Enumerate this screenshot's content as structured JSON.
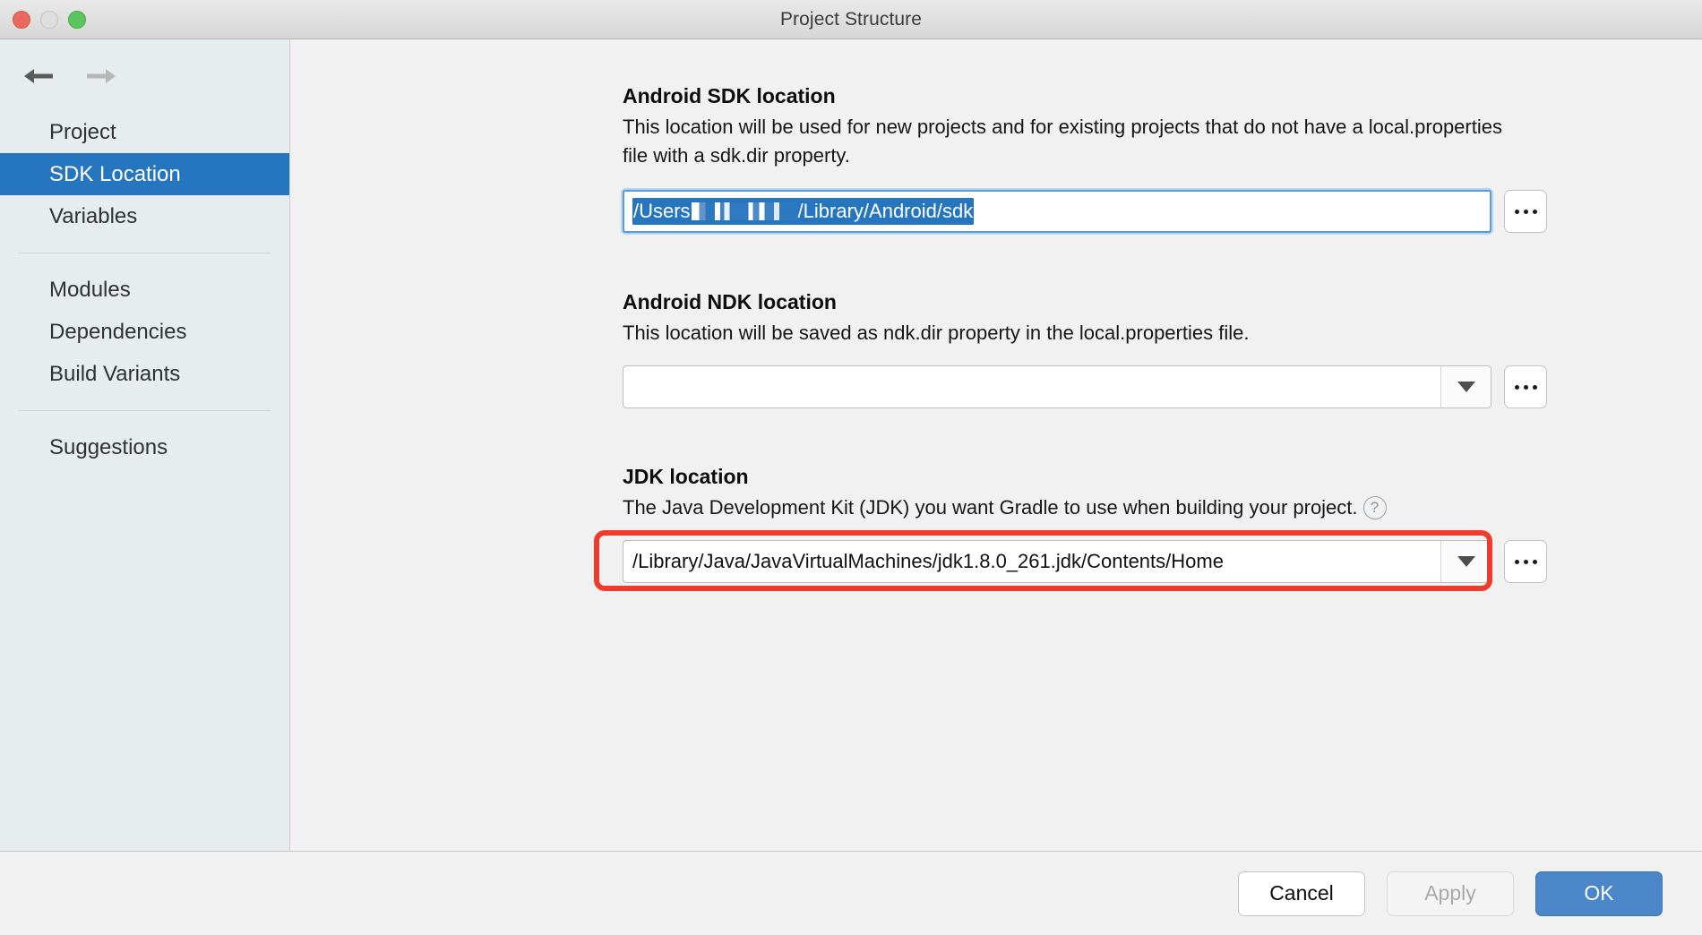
{
  "window": {
    "title": "Project Structure",
    "controls": {
      "close": "close",
      "minimize": "minimize",
      "maximize": "maximize"
    }
  },
  "nav": {
    "back_label": "Back",
    "forward_label": "Forward",
    "items": [
      {
        "label": "Project",
        "selected": false
      },
      {
        "label": "SDK Location",
        "selected": true
      },
      {
        "label": "Variables",
        "selected": false
      },
      {
        "label": "Modules",
        "selected": false
      },
      {
        "label": "Dependencies",
        "selected": false
      },
      {
        "label": "Build Variants",
        "selected": false
      },
      {
        "label": "Suggestions",
        "selected": false
      }
    ]
  },
  "sections": {
    "sdk": {
      "title": "Android SDK location",
      "description": "This location will be used for new projects and for existing projects that do not have a local.properties file with a sdk.dir property.",
      "value_prefix": "/Users",
      "value_suffix": "/Library/Android/sdk",
      "browse_label": "...",
      "redacted": true
    },
    "ndk": {
      "title": "Android NDK location",
      "description": "This location will be saved as ndk.dir property in the local.properties file.",
      "value": "",
      "browse_label": "...",
      "dropdown_label": "Show NDK options"
    },
    "jdk": {
      "title": "JDK location",
      "description": "The Java Development Kit (JDK) you want Gradle to use when building your project.",
      "help_label": "?",
      "value": "/Library/Java/JavaVirtualMachines/jdk1.8.0_261.jdk/Contents/Home",
      "browse_label": "...",
      "dropdown_label": "Show JDK options"
    }
  },
  "annotation": {
    "color": "#ef3b2c",
    "target": "jdk-location-row"
  },
  "footer": {
    "cancel_label": "Cancel",
    "apply_label": "Apply",
    "ok_label": "OK",
    "apply_disabled": true
  },
  "colors": {
    "accent": "#2675bf",
    "ok_button": "#4a86c8",
    "annotation": "#ef3b2c",
    "sidebar_bg": "#e7ecef",
    "content_bg": "#f1f1f1"
  }
}
